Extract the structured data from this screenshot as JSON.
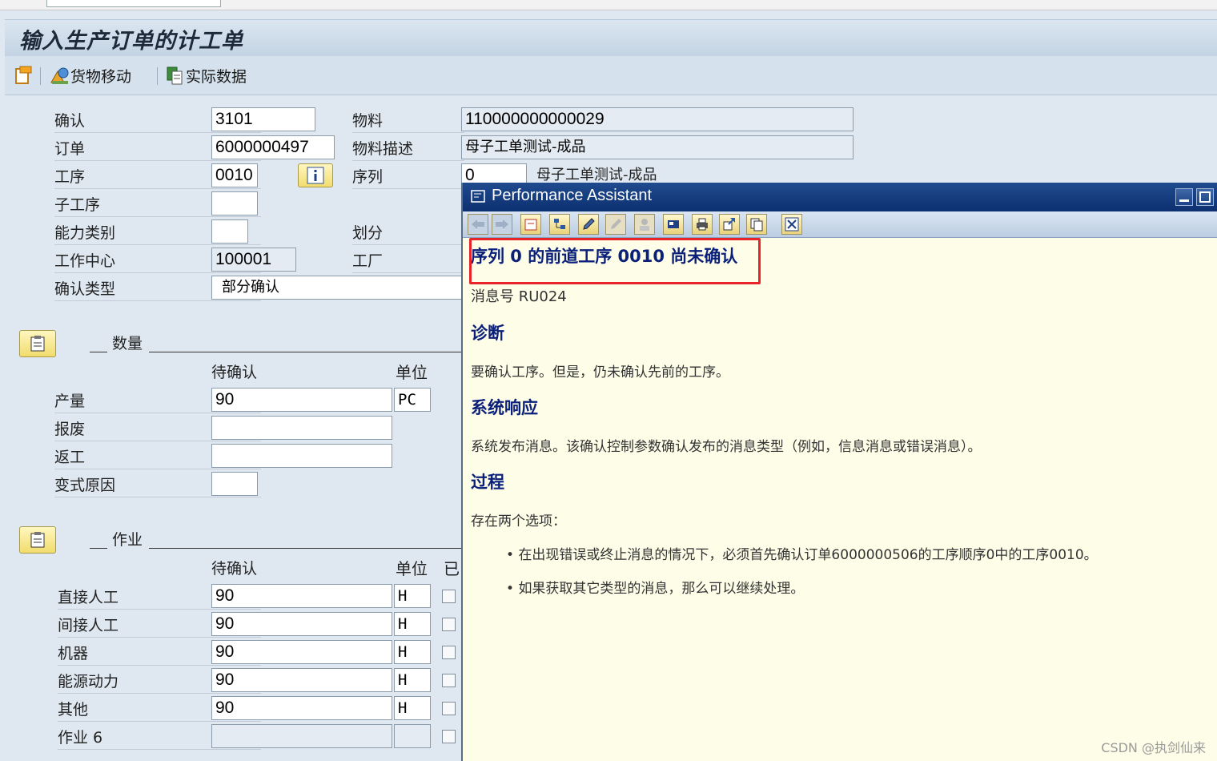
{
  "window": {
    "title": "输入生产订单的计工单"
  },
  "toolbar": {
    "goods_movement": "货物移动",
    "actual_data": "实际数据"
  },
  "header": {
    "confirmation_label": "确认",
    "confirmation_value": "3101",
    "order_label": "订单",
    "order_value": "6000000497",
    "operation_label": "工序",
    "operation_value": "0010",
    "sub_operation_label": "子工序",
    "sub_operation_value": "",
    "capacity_cat_label": "能力类别",
    "capacity_cat_value": "",
    "work_center_label": "工作中心",
    "work_center_value": "100001",
    "conf_type_label": "确认类型",
    "conf_type_value": "部分确认",
    "material_label": "物料",
    "material_value": "110000000000029",
    "material_desc_label": "物料描述",
    "material_desc_value": "母子工单测试-成品",
    "sequence_label": "序列",
    "sequence_value": "0",
    "sequence_desc": "母子工单测试-成品",
    "split_label": "划分",
    "plant_label": "工厂"
  },
  "quantities": {
    "section_title": "数量",
    "col_to_confirm": "待确认",
    "col_unit": "单位",
    "rows": [
      {
        "label": "产量",
        "value": "90",
        "unit": "PC"
      },
      {
        "label": "报废",
        "value": "",
        "unit": ""
      },
      {
        "label": "返工",
        "value": "",
        "unit": ""
      },
      {
        "label": "变式原因",
        "value": "",
        "unit": ""
      }
    ]
  },
  "activities": {
    "section_title": "作业",
    "col_to_confirm": "待确认",
    "col_unit": "单位",
    "col_final_partial": "已",
    "rows": [
      {
        "label": "直接人工",
        "value": "90",
        "unit": "H"
      },
      {
        "label": "间接人工",
        "value": "90",
        "unit": "H"
      },
      {
        "label": "机器",
        "value": "90",
        "unit": "H"
      },
      {
        "label": "能源动力",
        "value": "90",
        "unit": "H"
      },
      {
        "label": "其他",
        "value": "90",
        "unit": "H"
      },
      {
        "label": "作业 6",
        "value": "",
        "unit": ""
      }
    ]
  },
  "performance_assistant": {
    "title": "Performance Assistant",
    "heading": "序列 0 的前道工序 0010 尚未确认",
    "message_no": "消息号 RU024",
    "diagnosis_title": "诊断",
    "diagnosis_text": "要确认工序。但是，仍未确认先前的工序。",
    "system_response_title": "系统响应",
    "system_response_text": "系统发布消息。该确认控制参数确认发布的消息类型（例如，信息消息或错误消息）。",
    "procedure_title": "过程",
    "procedure_text": "存在两个选项：",
    "bullets": [
      "在出现错误或终止消息的情况下，必须首先确认订单6000000506的工序顺序0中的工序0010。",
      "如果获取其它类型的消息，那么可以继续处理。"
    ]
  },
  "watermark": "CSDN @执剑仙来"
}
